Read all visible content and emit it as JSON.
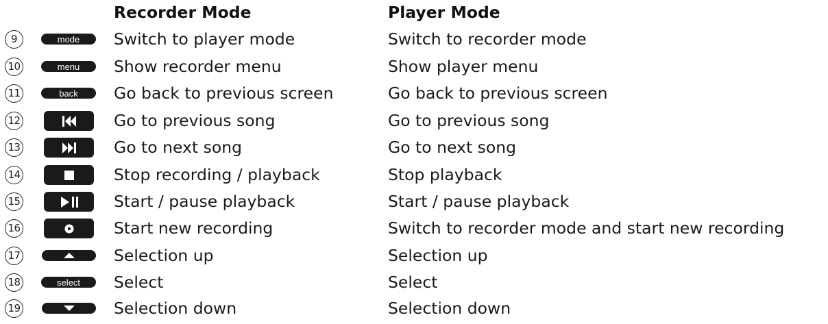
{
  "headers": {
    "recorder": "Recorder Mode",
    "player": "Player Mode"
  },
  "rows": [
    {
      "num": "9",
      "key": "mode",
      "recorder": "Switch to player mode",
      "player": "Switch to recorder mode"
    },
    {
      "num": "10",
      "key": "menu",
      "recorder": "Show recorder menu",
      "player": "Show player menu"
    },
    {
      "num": "11",
      "key": "back",
      "recorder": "Go back to previous screen",
      "player": "Go back to previous screen"
    },
    {
      "num": "12",
      "key": "",
      "icon": "previous-icon",
      "recorder": "Go to previous song",
      "player": "Go to previous song"
    },
    {
      "num": "13",
      "key": "",
      "icon": "next-icon",
      "recorder": "Go to next song",
      "player": "Go to next song"
    },
    {
      "num": "14",
      "key": "",
      "icon": "stop-icon",
      "recorder": "Stop recording / playback",
      "player": "Stop playback"
    },
    {
      "num": "15",
      "key": "",
      "icon": "play-pause-icon",
      "recorder": "Start / pause playback",
      "player": "Start / pause playback"
    },
    {
      "num": "16",
      "key": "",
      "icon": "record-icon",
      "recorder": "Start new recording",
      "player": "Switch to recorder mode and start new recording"
    },
    {
      "num": "17",
      "key": "",
      "icon": "up-arrow-icon",
      "recorder": "Selection up",
      "player": "Selection up"
    },
    {
      "num": "18",
      "key": "select",
      "recorder": "Select",
      "player": "Select"
    },
    {
      "num": "19",
      "key": "",
      "icon": "down-arrow-icon",
      "recorder": "Selection down",
      "player": "Selection down"
    }
  ]
}
